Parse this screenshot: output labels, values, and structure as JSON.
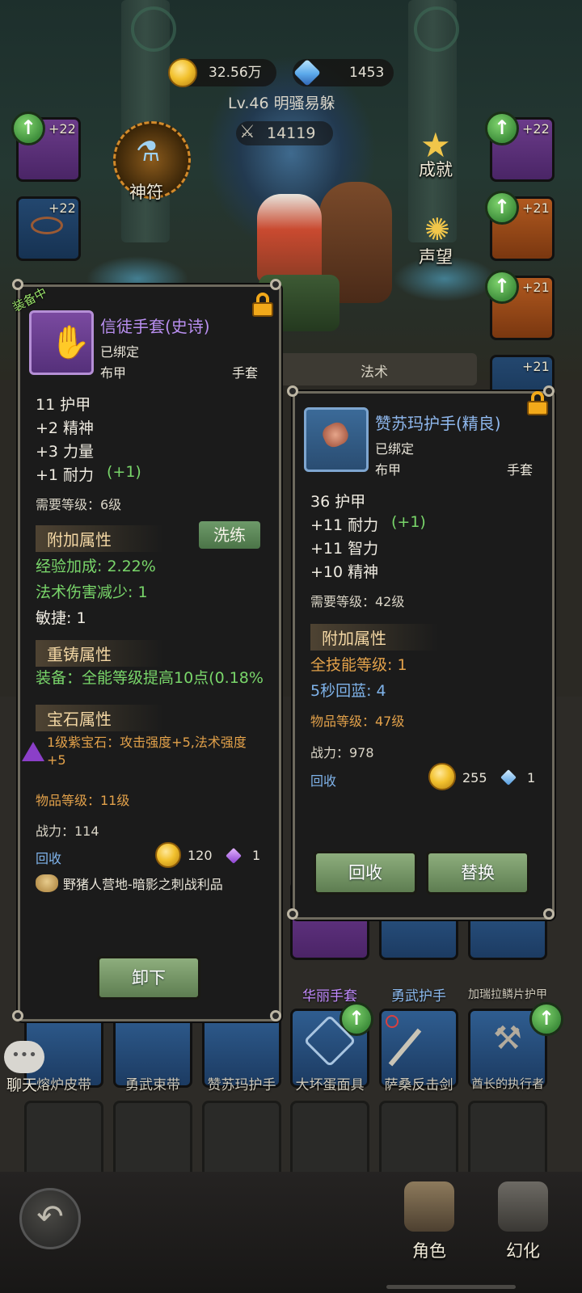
{
  "header": {
    "gold": "32.56万",
    "gems": "1453",
    "level_name": "Lv.46 明骚易躲",
    "power": "14119"
  },
  "left_slots": [
    {
      "bonus": "+22"
    },
    {
      "bonus": "+22"
    }
  ],
  "right_slots": [
    {
      "bonus": "+22"
    },
    {
      "bonus": "+21"
    },
    {
      "bonus": "+21"
    },
    {
      "bonus": "+21"
    }
  ],
  "menu": {
    "rune": "神符",
    "achievement": "成就",
    "reputation": "声望"
  },
  "tab_label": "法术",
  "equipped_card": {
    "badge": "装备中",
    "name": "信徒手套(史诗)",
    "bound": "已绑定",
    "armor_type": "布甲",
    "slot": "手套",
    "stats": [
      "11 护甲",
      "+2 精神",
      "+3 力量",
      "+1 耐力"
    ],
    "stat_bonus": "(+1)",
    "req_level": "需要等级：6级",
    "extra_title": "附加属性",
    "wash_button": "洗练",
    "extra_attrs": [
      "经验加成: 2.22%",
      "法术伤害减少: 1"
    ],
    "extra_plain": "敏捷: 1",
    "reforge_title": "重铸属性",
    "reforge_attr": "装备：全能等级提高10点(0.18%",
    "gem_title": "宝石属性",
    "gem_attr": "1级紫宝石：攻击强度+5,法术强度+5",
    "item_level": "物品等级：11级",
    "power": "战力：114",
    "recycle": "回收",
    "recycle_gold": "120",
    "recycle_gem": "1",
    "source": "野猪人营地-暗影之刺战利品",
    "unequip_button": "卸下"
  },
  "compare_card": {
    "name": "赞苏玛护手(精良)",
    "bound": "已绑定",
    "armor_type": "布甲",
    "slot": "手套",
    "stats": [
      "36 护甲",
      "+11 耐力",
      "+11 智力",
      "+10 精神"
    ],
    "stat_bonus": "(+1)",
    "req_level": "需要等级：42级",
    "extra_title": "附加属性",
    "extra_attrs": [
      "全技能等级: 1",
      "5秒回蓝: 4"
    ],
    "item_level": "物品等级：47级",
    "power": "战力：978",
    "recycle": "回收",
    "recycle_gold": "255",
    "recycle_gem": "1",
    "recycle_button": "回收",
    "replace_button": "替换"
  },
  "inventory": {
    "row1_labels": [
      "华丽手套",
      "勇武护手",
      "加瑞拉鳞片护甲"
    ],
    "row2_labels": [
      "熔炉皮带",
      "勇武束带",
      "赞苏玛护手",
      "大坏蛋面具",
      "萨桑反击剑",
      "酋长的执行者"
    ]
  },
  "chat_label": "聊天",
  "bottom_nav": {
    "character": "角色",
    "transform": "幻化"
  }
}
